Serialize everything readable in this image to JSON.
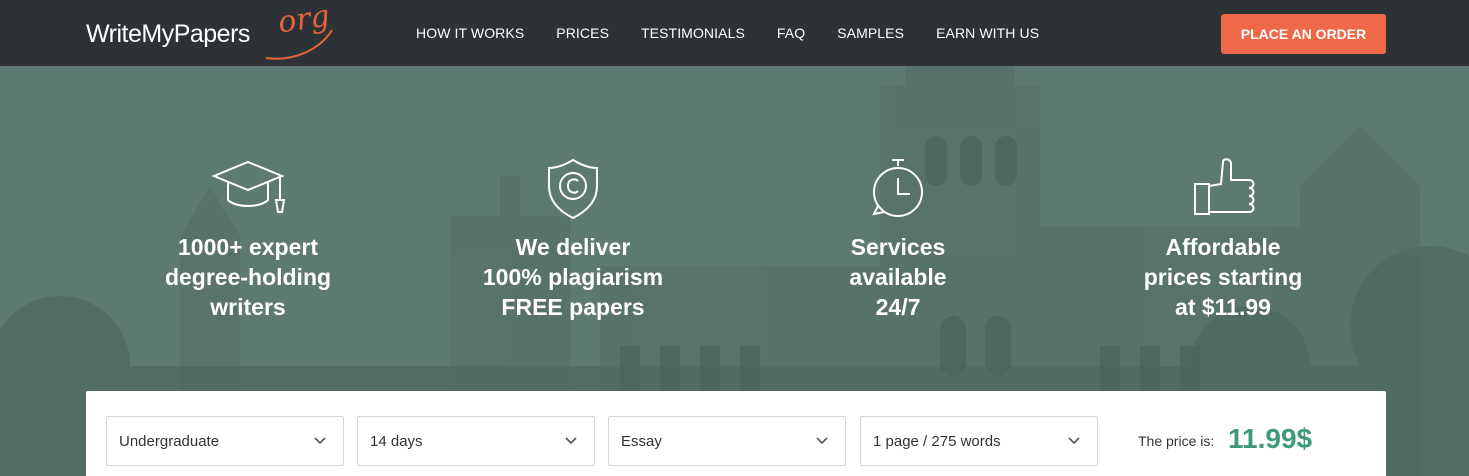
{
  "header": {
    "logo_main": "WriteMyPapers",
    "logo_suffix": "org",
    "nav": [
      "HOW IT WORKS",
      "PRICES",
      "TESTIMONIALS",
      "FAQ",
      "SAMPLES",
      "EARN WITH US"
    ],
    "cta_label": "PLACE AN ORDER"
  },
  "features": [
    {
      "icon": "graduation-cap-icon",
      "text": "1000+ expert\ndegree-holding\nwriters"
    },
    {
      "icon": "copyright-shield-icon",
      "text": "We deliver\n100% plagiarism\nFREE papers"
    },
    {
      "icon": "stopwatch-icon",
      "text": "Services\navailable\n24/7"
    },
    {
      "icon": "thumbs-up-icon",
      "text": "Affordable\nprices starting\nat $11.99"
    }
  ],
  "calculator": {
    "selects": [
      "Undergraduate",
      "14 days",
      "Essay",
      "1 page / 275 words"
    ],
    "price_label": "The price is:",
    "price_value": "11.99$"
  },
  "colors": {
    "header_bg": "#2c3236",
    "accent": "#ef6848",
    "hero_tint": "#5b7a72",
    "price_green": "#3f9a7a"
  }
}
